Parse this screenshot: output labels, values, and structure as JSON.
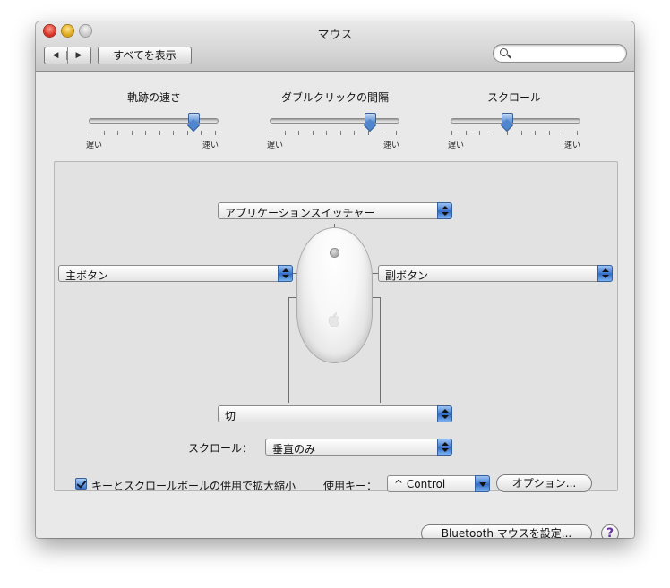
{
  "window": {
    "title": "マウス"
  },
  "toolbar": {
    "back_icon": "triangle-left-icon",
    "forward_icon": "triangle-right-icon",
    "show_all_label": "すべてを表示",
    "search_placeholder": "",
    "search_icon": "magnifier-icon"
  },
  "sliders": [
    {
      "name": "tracking",
      "title": "軌跡の速さ",
      "min_label": "遅い",
      "max_label": "速い",
      "value_fraction": 0.82
    },
    {
      "name": "double-click",
      "title": "ダブルクリックの間隔",
      "min_label": "遅い",
      "max_label": "速い",
      "value_fraction": 0.78
    },
    {
      "name": "scroll",
      "title": "スクロール",
      "min_label": "遅い",
      "max_label": "速い",
      "value_fraction": 0.44
    }
  ],
  "mouse_buttons": {
    "top": "アプリケーションスイッチャー",
    "left": "主ボタン",
    "right": "副ボタン",
    "bottom": "切"
  },
  "scroll": {
    "label": "スクロール：",
    "value": "垂直のみ"
  },
  "zoom": {
    "checkbox_label": "キーとスクロールボールの併用で拡大縮小",
    "checked": true,
    "modifier_label": "使用キー：",
    "modifier_value": "^ Control",
    "options_button": "オプション..."
  },
  "footer": {
    "bluetooth_button": "Bluetooth マウスを設定...",
    "help_label": "?"
  },
  "colors": {
    "accent": "#3f7ad2",
    "window_bg": "#e9e9e9",
    "panel_bg": "#e2e2e2",
    "help_icon": "#6a2fa8"
  }
}
